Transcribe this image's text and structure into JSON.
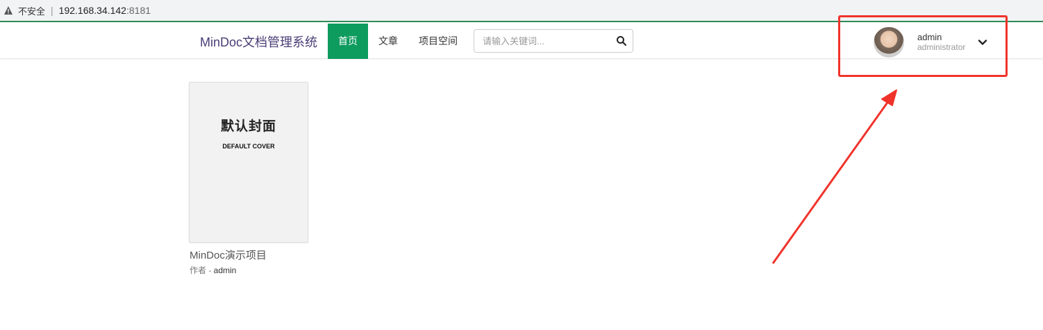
{
  "browser": {
    "security_label": "不安全",
    "url_host": "192.168.34.142",
    "url_port": ":8181"
  },
  "navbar": {
    "brand": "MinDoc文档管理系统",
    "items": [
      {
        "label": "首页",
        "active": true
      },
      {
        "label": "文章",
        "active": false
      },
      {
        "label": "项目空间",
        "active": false
      }
    ],
    "search_placeholder": "请输入关键词...",
    "user": {
      "name": "admin",
      "role": "administrator"
    }
  },
  "projects": [
    {
      "cover_title_cn": "默认封面",
      "cover_title_en": "DEFAULT COVER",
      "name": "MinDoc演示项目",
      "author_prefix": "作者 - ",
      "author": "admin"
    }
  ],
  "colors": {
    "active_nav": "#0d9b5e",
    "brand": "#4a3c76",
    "annotation": "#f0332a"
  }
}
